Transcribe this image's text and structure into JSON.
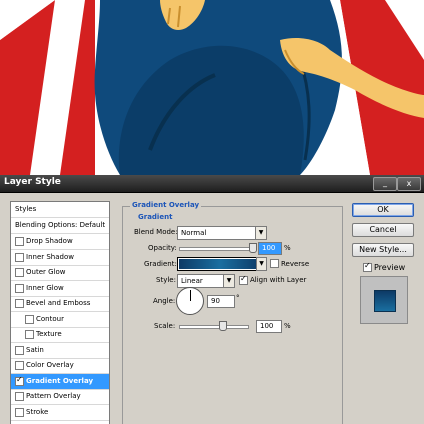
{
  "dialog": {
    "title": "Layer Style",
    "minimize_symbol": "_",
    "close_symbol": "x"
  },
  "styles_list": {
    "header": "Styles",
    "blending_options": "Blending Options: Default",
    "items": [
      {
        "label": "Drop Shadow",
        "checked": false,
        "indent": false,
        "selected": false
      },
      {
        "label": "Inner Shadow",
        "checked": false,
        "indent": false,
        "selected": false
      },
      {
        "label": "Outer Glow",
        "checked": false,
        "indent": false,
        "selected": false
      },
      {
        "label": "Inner Glow",
        "checked": false,
        "indent": false,
        "selected": false
      },
      {
        "label": "Bevel and Emboss",
        "checked": false,
        "indent": false,
        "selected": false
      },
      {
        "label": "Contour",
        "checked": false,
        "indent": true,
        "selected": false
      },
      {
        "label": "Texture",
        "checked": false,
        "indent": true,
        "selected": false
      },
      {
        "label": "Satin",
        "checked": false,
        "indent": false,
        "selected": false
      },
      {
        "label": "Color Overlay",
        "checked": false,
        "indent": false,
        "selected": false
      },
      {
        "label": "Gradient Overlay",
        "checked": true,
        "indent": false,
        "selected": true
      },
      {
        "label": "Pattern Overlay",
        "checked": false,
        "indent": false,
        "selected": false
      },
      {
        "label": "Stroke",
        "checked": false,
        "indent": false,
        "selected": false
      }
    ]
  },
  "gradient_overlay": {
    "group_title": "Gradient Overlay",
    "sub_title": "Gradient",
    "blend_mode_label": "Blend Mode:",
    "blend_mode_value": "Normal",
    "opacity_label": "Opacity:",
    "opacity_value": "100",
    "opacity_unit": "%",
    "opacity_fraction": 1.0,
    "gradient_label": "Gradient:",
    "gradient_colors": [
      "#0d3a66",
      "#1a6fa0",
      "#0d3a66"
    ],
    "reverse_label": "Reverse",
    "reverse_checked": false,
    "style_label": "Style:",
    "style_value": "Linear",
    "align_label": "Align with Layer",
    "align_checked": true,
    "angle_label": "Angle:",
    "angle_value": "90",
    "angle_unit": "°",
    "scale_label": "Scale:",
    "scale_value": "100",
    "scale_unit": "%",
    "scale_fraction": 0.65
  },
  "buttons": {
    "ok": "OK",
    "cancel": "Cancel",
    "new_style": "New Style...",
    "preview_label": "Preview",
    "preview_checked": true
  },
  "colors": {
    "accent_blue": "#3399ff",
    "title_blue": "#1c55b8",
    "flag_red": "#d42020",
    "jeans_blue": "#0f4a7c",
    "skin": "#f5c56a"
  }
}
